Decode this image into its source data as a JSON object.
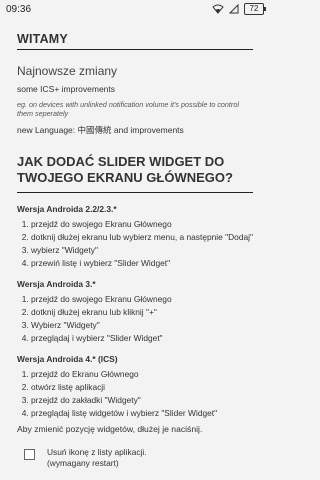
{
  "statusbar": {
    "time": "09:36",
    "battery": "72"
  },
  "welcome": {
    "title": "WITAMY"
  },
  "changes": {
    "title": "Najnowsze zmiany",
    "line1": "some ICS+ improvements",
    "note": "eg. on devices with unlinked notification volume it's possible to control them seperately",
    "line2": "new Language: 中國傳統 and improvements"
  },
  "howto": {
    "title_line1": "JAK DODAĆ SLIDER WIDGET DO",
    "title_line2": "TWOJEGO EKRANU GŁÓWNEGO?"
  },
  "sections": [
    {
      "title": "Wersja Androida 2.2/2.3.*",
      "steps": [
        "przejdź do swojego Ekranu Głównego",
        "dotknij dłużej ekranu lub wybierz menu, a następnie \"Dodaj\"",
        "wybierz \"Widgety\"",
        "przewiń listę i wybierz \"Slider Widget\""
      ]
    },
    {
      "title": "Wersja Androida 3.*",
      "steps": [
        "przejdź do swojego Ekranu Głównego",
        "dotknij dłużej ekranu lub kliknij \"+\"",
        "Wybierz \"Widgety\"",
        "przeglądaj i wybierz \"Slider Widget\""
      ]
    },
    {
      "title": "Wersja Androida 4.* (ICS)",
      "steps": [
        "przejdź do Ekranu Głównego",
        "otwórz listę aplikacji",
        "przejdź do zakładki \"Widgety\"",
        "przeglądaj listę widgetów i wybierz \"Slider Widget\""
      ]
    }
  ],
  "footer": {
    "text": "Aby zmienić pozycję widgetów, dłużej je naciśnij.",
    "checkbox_label_1": "Usuń ikonę z listy aplikacji.",
    "checkbox_label_2": "(wymagany restart)",
    "checkbox_checked": false
  }
}
